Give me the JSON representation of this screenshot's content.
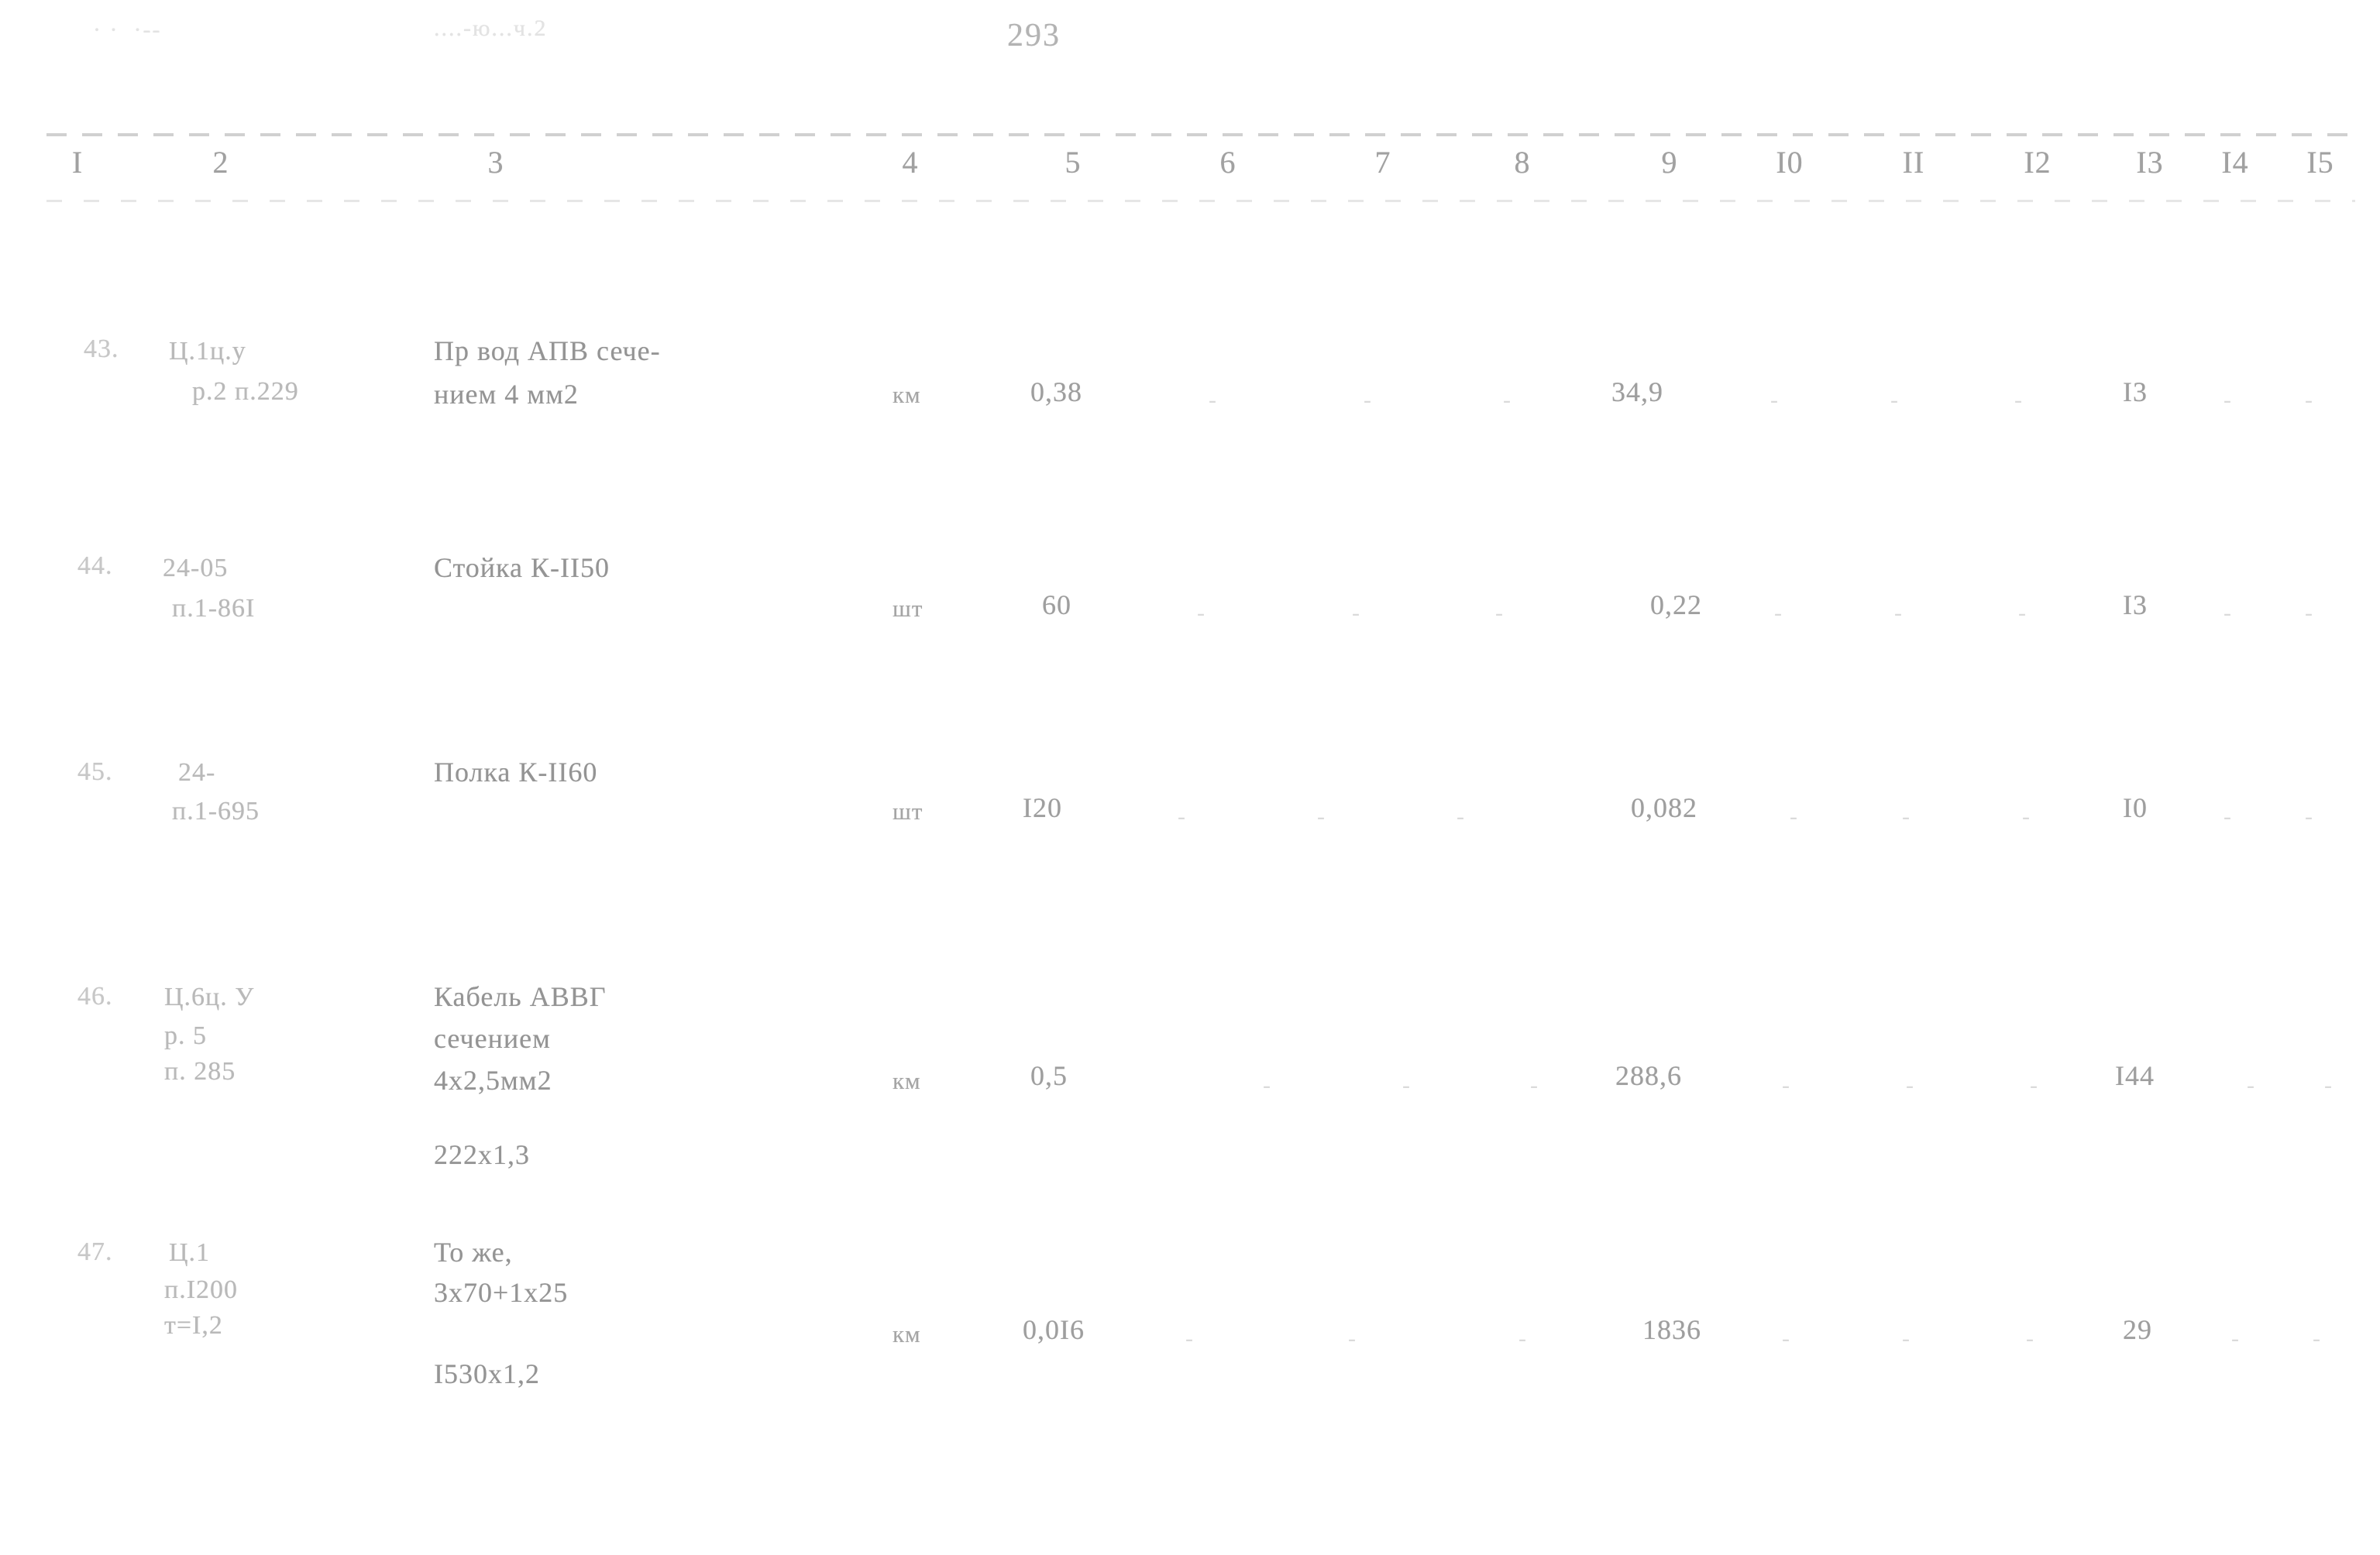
{
  "document": {
    "page_number": "293",
    "top_marginalia_left": "· ·  ·--",
    "top_marginalia_center": "....-ю...ч.2",
    "language": "ru"
  },
  "table": {
    "column_numbers": [
      "I",
      "2",
      "3",
      "4",
      "5",
      "6",
      "7",
      "8",
      "9",
      "I0",
      "II",
      "I2",
      "I3",
      "I4",
      "I5"
    ],
    "empty_dash": "-",
    "rows": [
      {
        "row_number": "43.",
        "code_lines": [
          "Ц.1ц.у",
          "р.2 п.229"
        ],
        "description_lines": [
          "Пр вод АПВ сече-",
          "нием 4 мм2"
        ],
        "unit": "км",
        "qty": "0,38",
        "col6": "-",
        "col7": "-",
        "col8": "-",
        "col9": "34,9",
        "col10": "-",
        "col11": "-",
        "col12": "-",
        "col13": "I3",
        "col14": "-",
        "col15": "-"
      },
      {
        "row_number": "44.",
        "code_lines": [
          "24-05",
          "п.1-86I"
        ],
        "description_lines": [
          "Стойка К-II50"
        ],
        "unit": "шт",
        "qty": "60",
        "col6": "-",
        "col7": "-",
        "col8": "-",
        "col9": "0,22",
        "col10": "-",
        "col11": "-",
        "col12": "-",
        "col13": "I3",
        "col14": "-",
        "col15": "-"
      },
      {
        "row_number": "45.",
        "code_lines": [
          "24-",
          "п.1-695"
        ],
        "description_lines": [
          "Полка К-II60"
        ],
        "unit": "шт",
        "qty": "I20",
        "col6": "-",
        "col7": "-",
        "col8": "-",
        "col9": "0,082",
        "col10": "-",
        "col11": "-",
        "col12": "-",
        "col13": "I0",
        "col14": "-",
        "col15": "-"
      },
      {
        "row_number": "46.",
        "code_lines": [
          "Ц.6ц. У",
          "р. 5",
          "п. 285"
        ],
        "description_lines": [
          "Кабель АВВГ",
          "сечением",
          "4х2,5мм2"
        ],
        "description_extra": "222х1,3",
        "unit": "км",
        "qty": "0,5",
        "col6": "-",
        "col7": "-",
        "col8": "-",
        "col9": "288,6",
        "col10": "-",
        "col11": "-",
        "col12": "-",
        "col13": "I44",
        "col14": "-",
        "col15": "-"
      },
      {
        "row_number": "47.",
        "code_lines": [
          "Ц.1",
          "п.I200",
          "т=I,2"
        ],
        "description_lines": [
          "То же,",
          "3х70+1х25"
        ],
        "description_extra": "I530х1,2",
        "unit": "км",
        "qty": "0,0I6",
        "col6": "-",
        "col7": "-",
        "col8": "-",
        "col9": "1836",
        "col10": "-",
        "col11": "-",
        "col12": "-",
        "col13": "29",
        "col14": "-",
        "col15": "-"
      }
    ]
  }
}
